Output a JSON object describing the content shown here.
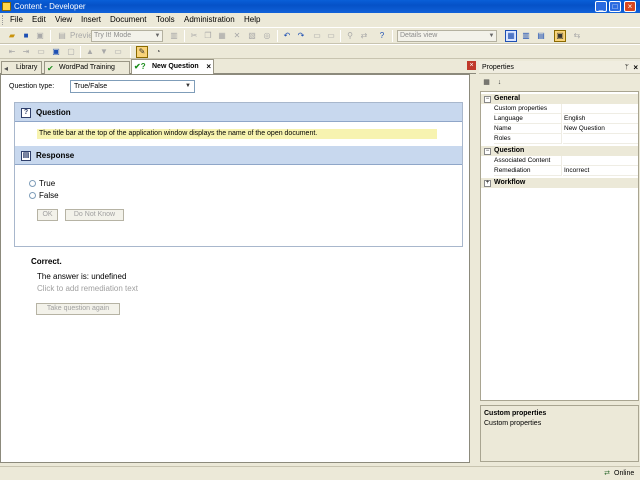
{
  "window": {
    "title": "Content - Developer",
    "controls": [
      "_",
      "□",
      "×"
    ]
  },
  "menubar": {
    "items": [
      {
        "label": "File"
      },
      {
        "label": "Edit"
      },
      {
        "label": "View"
      },
      {
        "label": "Insert"
      },
      {
        "label": "Document"
      },
      {
        "label": "Tools"
      },
      {
        "label": "Administration"
      },
      {
        "label": "Help"
      }
    ]
  },
  "toolbar": {
    "preview_label": "Preview",
    "mode_select": "Try It! Mode",
    "view_select": "Details view"
  },
  "tabs": [
    {
      "label": "Library",
      "icon": "library-icon",
      "selected": false
    },
    {
      "label": "WordPad Training",
      "icon": "check-doc-icon",
      "selected": false
    },
    {
      "label": "New Question",
      "icon": "question-check-icon",
      "selected": true,
      "closable": true
    }
  ],
  "editor": {
    "question_type_label": "Question type:",
    "question_type_value": "True/False",
    "question_section": "Question",
    "question_text": "The title bar at the top of the application window displays the name of the open document.",
    "response_section": "Response",
    "options": [
      {
        "label": "True",
        "selected": false
      },
      {
        "label": "False",
        "selected": false
      }
    ],
    "ok_button": "OK",
    "do_not_know_button": "Do Not Know",
    "feedback_title": "Correct.",
    "feedback_answer": "The answer is: undefined",
    "feedback_hint": "Click to add remediation text",
    "take_again_button": "Take question again"
  },
  "properties": {
    "title": "Properties",
    "pin_symbol": "ᛘ",
    "close_symbol": "×",
    "categories": [
      {
        "name": "General",
        "expanded": true,
        "rows": [
          {
            "key": "Custom properties",
            "value": ""
          },
          {
            "key": "Language",
            "value": "English"
          },
          {
            "key": "Name",
            "value": "New Question"
          },
          {
            "key": "Roles",
            "value": ""
          }
        ]
      },
      {
        "name": "Question",
        "expanded": true,
        "rows": [
          {
            "key": "Associated Content",
            "value": ""
          },
          {
            "key": "Remediation",
            "value": "Incorrect"
          }
        ]
      },
      {
        "name": "Workflow",
        "expanded": false,
        "rows": []
      }
    ],
    "description_title": "Custom properties",
    "description_text": "Custom properties"
  },
  "status": {
    "text": "Online"
  },
  "colors": {
    "titlebar": "#0a5fd8",
    "section_header": "#c8d8ee",
    "question_highlight": "#f7f3b0",
    "tab_close_red": "#c0392b"
  }
}
